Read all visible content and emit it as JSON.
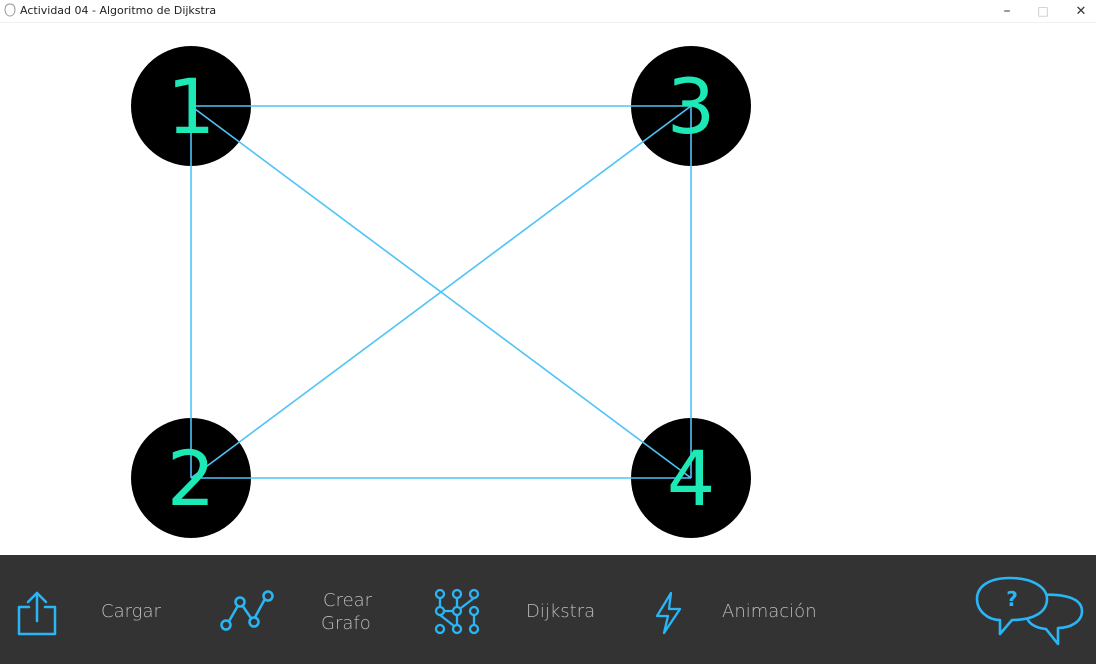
{
  "window": {
    "title": "Actividad 04 - Algoritmo de Dijkstra",
    "minimize_glyph": "–",
    "maximize_glyph": "□",
    "close_glyph": "✕"
  },
  "graph": {
    "node_fill": "#000000",
    "label_color": "#1de9b6",
    "edge_color": "#4fc3f7",
    "nodes": [
      {
        "id": "1",
        "label": "1"
      },
      {
        "id": "3",
        "label": "3"
      },
      {
        "id": "2",
        "label": "2"
      },
      {
        "id": "4",
        "label": "4"
      }
    ],
    "edges": [
      {
        "from": "1",
        "to": "3"
      },
      {
        "from": "1",
        "to": "2"
      },
      {
        "from": "1",
        "to": "4"
      },
      {
        "from": "3",
        "to": "2"
      },
      {
        "from": "3",
        "to": "4"
      },
      {
        "from": "2",
        "to": "4"
      }
    ]
  },
  "toolbar": {
    "background": "#333333",
    "icon_color": "#29b6f6",
    "items": [
      {
        "name": "cargar",
        "label": "Cargar",
        "icon": "upload-icon"
      },
      {
        "name": "crear-grafo",
        "label_line1": "Crear",
        "label_line2": "Grafo",
        "icon": "graph-path-icon"
      },
      {
        "name": "dijkstra",
        "label": "Dijkstra",
        "icon": "node-grid-icon"
      },
      {
        "name": "animacion",
        "label": "Animación",
        "icon": "lightning-icon"
      },
      {
        "name": "help",
        "icon": "help-chat-icon",
        "help_glyph": "?"
      }
    ]
  }
}
